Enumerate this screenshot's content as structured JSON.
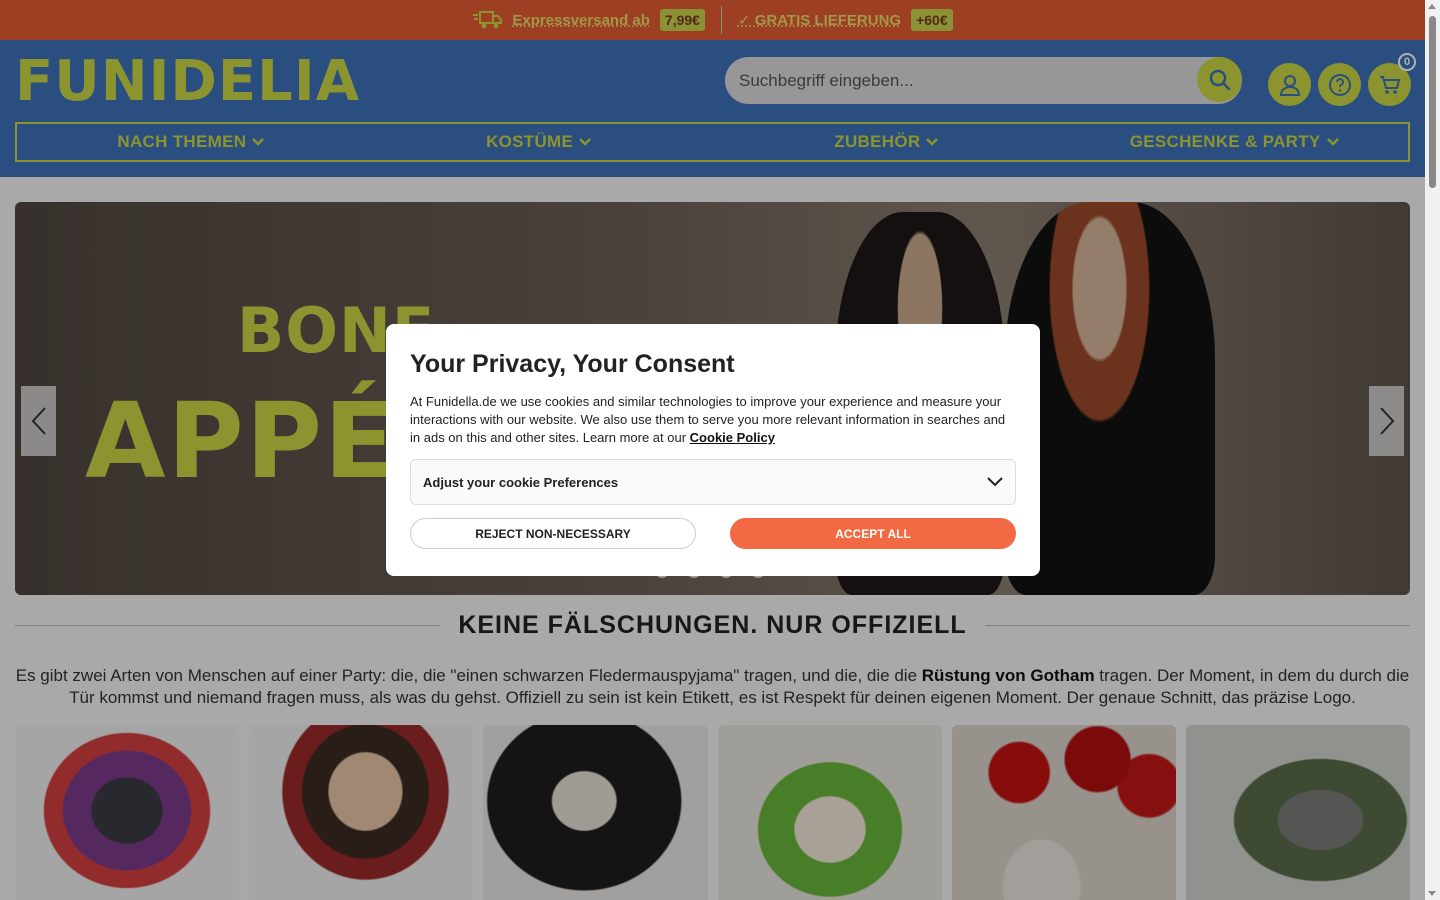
{
  "topbar": {
    "express_label": "Expressversand ab",
    "express_price": "7,99€",
    "free_label": "✓ GRATIS LIEFERUNG",
    "free_threshold": "+60€"
  },
  "header": {
    "logo": "FUNIDELIA",
    "search_placeholder": "Suchbegriff eingeben...",
    "cart_count": "0",
    "nav": [
      {
        "label": "NACH THEMEN"
      },
      {
        "label": "KOSTÜME"
      },
      {
        "label": "ZUBEHÖR"
      },
      {
        "label": "GESCHENKE & PARTY"
      }
    ]
  },
  "hero": {
    "line1": "BONE",
    "line2": "APPÉ"
  },
  "section": {
    "title": "KEINE FÄLSCHUNGEN. NUR OFFIZIELL",
    "intro_before": "Es gibt zwei Arten von Menschen auf einer Party: die, die \"einen schwarzen Fledermauspyjama\" tragen, und die, die die ",
    "intro_bold": "Rüstung von Gotham",
    "intro_after": " tragen. Der Moment, in dem du durch die Tür kommst und niemand fragen muss, als was du gehst. Offiziell zu sein ist kein Etikett, es ist Respekt für deinen eigenen Moment. Der genaue Schnitt, das präzise Logo."
  },
  "consent": {
    "title": "Your Privacy, Your Consent",
    "body": "At Funidella.de we use cookies and similar technologies to improve your experience and measure your interactions with our website. We also use them to serve you more relevant information in searches and in ads on this and other sites. Learn more at our ",
    "policy_link": "Cookie Policy",
    "preferences": "Adjust your cookie Preferences",
    "reject": "REJECT NON-NECESSARY",
    "accept": "ACCEPT ALL"
  },
  "colors": {
    "brand_blue": "#3d70b6",
    "brand_lime": "#c9d545",
    "topbar_orange": "#e05b33",
    "accept_orange": "#f26a44"
  }
}
